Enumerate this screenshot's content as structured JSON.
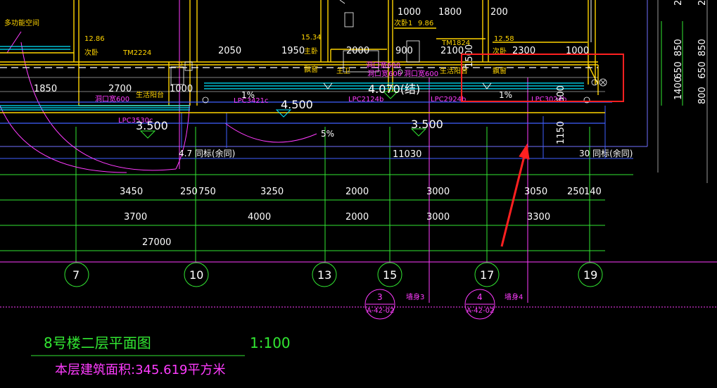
{
  "labels": {
    "multi_room": "多功能空间",
    "sec_bed_area": "12.86",
    "sec_bed": "次卧",
    "tm2224": "TM2224",
    "area_1534": "15.34",
    "tm1824": "TM1824",
    "area_1258": "12.58",
    "sec_bed_r": "次卧",
    "sec_bed1": "次卧1",
    "area_986": "9.86",
    "main_bed": "主卧",
    "bay_win_l": "飘窗",
    "main_wc": "主卫",
    "balcony_l": "生活阳台",
    "balcony_r": "生活阳台",
    "bay_win_r": "飘窗",
    "toilet": "卫",
    "lpc3421": "LPC3421c",
    "lpc2124": "LPC2124b",
    "lpc2924": "LPC2924b",
    "lpc3024": "LPC3024b",
    "lpc3530": "LPC3530c",
    "slope_1a": "1%",
    "slope_1b": "1%",
    "slope_5": "5%",
    "opening_w": "洞口宽600",
    "opening_w2": "洞口宽600",
    "opening_w3": "洞口宽600",
    "hole_600": "洞口宽600",
    "wall_height_l": "4.7 同标(余同)",
    "wall_height_r": "30 同标(余同)",
    "wall3": "墙身3",
    "wall4": "墙身4"
  },
  "dims_top": [
    "1000",
    "1800",
    "200",
    "2050",
    "1950",
    "2000",
    "900",
    "2100",
    "2300",
    "1000",
    "1850",
    "2700",
    "1000",
    "1500",
    "600"
  ],
  "dims_right": [
    "850",
    "650",
    "850",
    "650",
    "1400",
    "800",
    "2",
    "2"
  ],
  "levels": [
    "4.070(结)",
    "4.500",
    "3.500",
    "3.500"
  ],
  "dim_mid": [
    "11030",
    "1150"
  ],
  "dim_row1": [
    "3450",
    "250",
    "750",
    "3250",
    "2000",
    "3000",
    "3050",
    "250",
    "140"
  ],
  "dim_row2": [
    "3700",
    "4000",
    "2000",
    "3000",
    "3300"
  ],
  "dim_total": "27000",
  "axes": [
    "7",
    "10",
    "13",
    "15",
    "17",
    "19"
  ],
  "sections": [
    {
      "num": "3",
      "ref": "A-42-02"
    },
    {
      "num": "4",
      "ref": "A-42-02"
    }
  ],
  "title": "8号楼二层平面图",
  "scale": "1:100",
  "area": "本层建筑面积:345.619平方米",
  "colors": {
    "background": "#000000",
    "wall": "#ffd400",
    "dim_line": "#32e632",
    "magenta": "#ff3cff",
    "cyan": "#00e5ff",
    "blue": "#4060ff",
    "annotation_red": "#ff2020"
  }
}
